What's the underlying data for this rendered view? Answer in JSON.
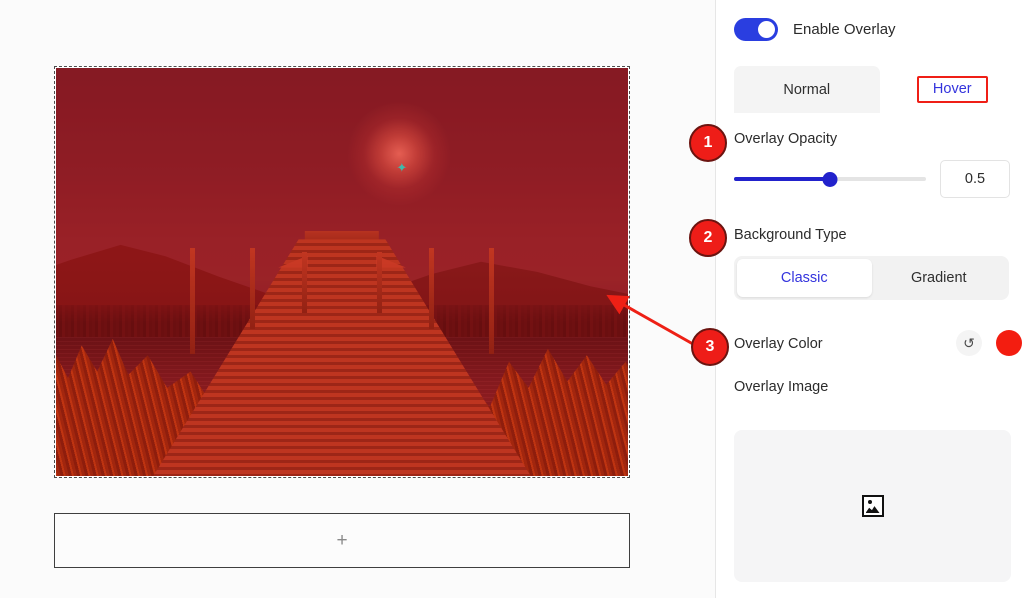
{
  "canvas": {
    "image": {
      "alt": "lake-dock-mountains-photo",
      "overlay_color": "#f31d10",
      "overlay_opacity": 0.5,
      "selected": true
    },
    "add_block": {
      "plus_label": "+"
    }
  },
  "panel": {
    "enable_overlay": {
      "label": "Enable Overlay",
      "enabled": true,
      "accent_color": "#2a3ee0"
    },
    "tabs": [
      {
        "label": "Normal",
        "active": false
      },
      {
        "label": "Hover",
        "active": true,
        "highlighted": true
      }
    ],
    "overlay_opacity": {
      "label": "Overlay Opacity",
      "value": "0.5",
      "percent": 50,
      "track_color": "#2222cc"
    },
    "background_type": {
      "label": "Background Type",
      "options": [
        {
          "label": "Classic",
          "selected": true
        },
        {
          "label": "Gradient",
          "selected": false
        }
      ]
    },
    "overlay_color": {
      "label": "Overlay Color",
      "swatch": "#f31d10",
      "reset_glyph": "↺"
    },
    "overlay_image": {
      "label": "Overlay Image",
      "placeholder_icon": "image-placeholder-icon"
    }
  },
  "annotations": {
    "badges": [
      {
        "number": "1",
        "target": "overlay-opacity"
      },
      {
        "number": "2",
        "target": "background-type"
      },
      {
        "number": "3",
        "target": "overlay-color"
      }
    ],
    "arrow_color": "#ee2015"
  }
}
